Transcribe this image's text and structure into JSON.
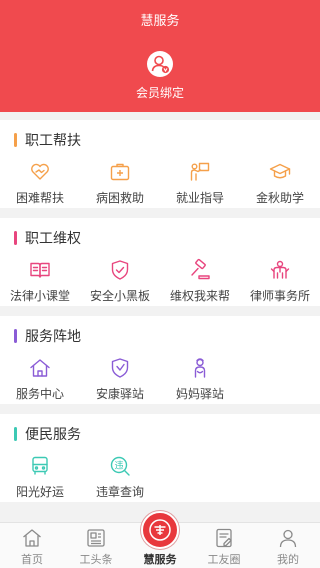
{
  "app_title": "慧服务",
  "member": {
    "label": "会员绑定",
    "icon": "member-bind-icon"
  },
  "sections": [
    {
      "title": "职工帮扶",
      "color": "#f5a04a",
      "items": [
        {
          "label": "困难帮扶",
          "icon": "heart-hands-icon"
        },
        {
          "label": "病困救助",
          "icon": "medical-kit-icon"
        },
        {
          "label": "就业指导",
          "icon": "presenter-icon"
        },
        {
          "label": "金秋助学",
          "icon": "graduation-cap-icon"
        }
      ]
    },
    {
      "title": "职工维权",
      "color": "#e8457e",
      "items": [
        {
          "label": "法律小课堂",
          "icon": "open-book-icon"
        },
        {
          "label": "安全小黑板",
          "icon": "shield-check-icon"
        },
        {
          "label": "维权我来帮",
          "icon": "gavel-icon"
        },
        {
          "label": "律师事务所",
          "icon": "lawyer-icon"
        }
      ]
    },
    {
      "title": "服务阵地",
      "color": "#8a5cd6",
      "items": [
        {
          "label": "服务中心",
          "icon": "home-icon"
        },
        {
          "label": "安康驿站",
          "icon": "shield-heart-icon"
        },
        {
          "label": "妈妈驿站",
          "icon": "mother-icon"
        }
      ]
    },
    {
      "title": "便民服务",
      "color": "#3cc9b4",
      "items": [
        {
          "label": "阳光好运",
          "icon": "bus-icon"
        },
        {
          "label": "违章查询",
          "icon": "violation-search-icon"
        }
      ]
    }
  ],
  "tabbar": [
    {
      "label": "首页",
      "icon": "home-tab-icon"
    },
    {
      "label": "工头条",
      "icon": "news-tab-icon"
    },
    {
      "label": "慧服务",
      "icon": "union-logo-icon",
      "active": true
    },
    {
      "label": "工友圈",
      "icon": "community-tab-icon"
    },
    {
      "label": "我的",
      "icon": "profile-tab-icon"
    }
  ]
}
